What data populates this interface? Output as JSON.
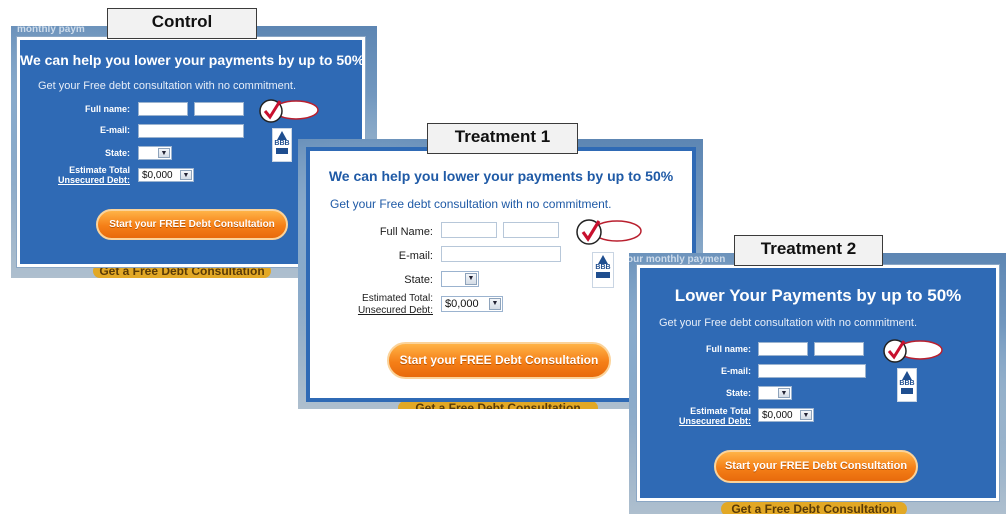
{
  "variants": {
    "control": {
      "label": "Control",
      "headline": "We can help you lower your payments by up to 50%",
      "subheadline": "Get your Free debt consultation with no commitment.",
      "fullname_label": "Full name:",
      "email_label": "E-mail:",
      "state_label": "State:",
      "debt_label_line1": "Estimate Total",
      "debt_label_line2": "Unsecured Debt:",
      "debt_value": "$0,000",
      "cta_label": "Start your FREE Debt Consultation",
      "bg_top_text": "monthly paym",
      "bg_bottom_text": "Get a Free Debt Consultation"
    },
    "treatment1": {
      "label": "Treatment 1",
      "headline": "We can help you lower your payments by up to 50%",
      "subheadline": "Get your Free debt consultation with no commitment.",
      "fullname_label": "Full Name:",
      "email_label": "E-mail:",
      "state_label": "State:",
      "debt_label_line1": "Estimated Total:",
      "debt_label_line2": "Unsecured Debt:",
      "debt_value": "$0,000",
      "cta_label": "Start your FREE Debt Consultation",
      "bg_bottom_text": "Get a Free Debt Consultation"
    },
    "treatment2": {
      "label": "Treatment 2",
      "headline": "Lower Your Payments by up to 50%",
      "subheadline": "Get your Free debt consultation with no commitment.",
      "fullname_label": "Full name:",
      "email_label": "E-mail:",
      "state_label": "State:",
      "debt_label_line1": "Estimate Total",
      "debt_label_line2": "Unsecured Debt:",
      "debt_value": "$0,000",
      "cta_label": "Start your FREE Debt Consultation",
      "bg_top_text": "our monthly paymen",
      "bg_bottom_text": "Get a Free Debt Consultation"
    }
  },
  "badges": {
    "verisign_line1": "VeriSign",
    "verisign_line2": "Secured",
    "bbb_text": "BBB"
  },
  "colors": {
    "panel_blue": "#2f6ab5",
    "headline_blue_on_white": "#1f5aa6",
    "cta_orange": "#f57f17"
  },
  "icons": [
    "verisign-check-icon",
    "bbb-torch-icon",
    "chevron-down-icon"
  ]
}
